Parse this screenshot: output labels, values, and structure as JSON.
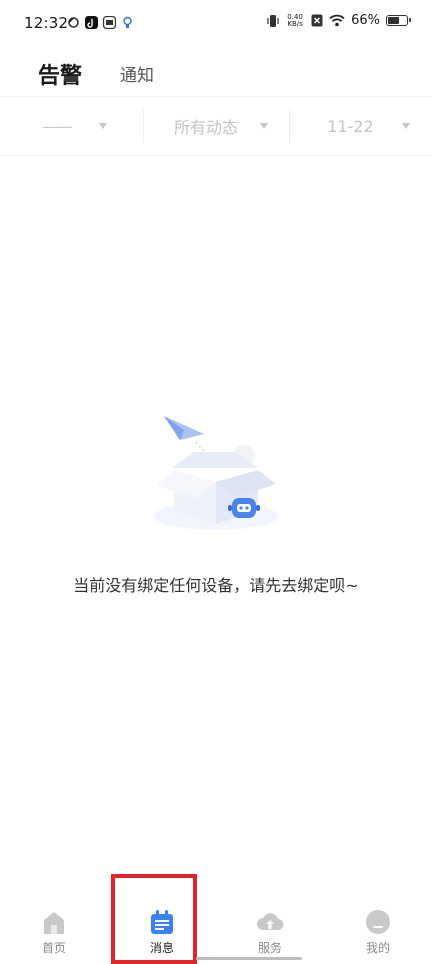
{
  "status_bar": {
    "time": "12:32",
    "net_speed_value": "0.40",
    "net_speed_unit": "KB/s",
    "battery_text": "66%",
    "battery_level": 0.66,
    "icons": [
      "sync-icon",
      "tiktok-icon",
      "app-icon",
      "bulb-icon",
      "vibrate-icon",
      "no-sim-icon",
      "wifi-icon",
      "battery-icon"
    ]
  },
  "header": {
    "tabs": [
      {
        "label": "告警",
        "active": true
      },
      {
        "label": "通知",
        "active": false
      }
    ]
  },
  "filters": {
    "device": "——",
    "dynamics": "所有动态",
    "date": "11-22"
  },
  "empty_state": {
    "message": "当前没有绑定任何设备，请先去绑定呗~",
    "illustration": "paper-plane-box-robot"
  },
  "bottom_nav": {
    "items": [
      {
        "label": "首页",
        "icon": "home-icon",
        "active": false
      },
      {
        "label": "消息",
        "icon": "message-calendar-icon",
        "active": true
      },
      {
        "label": "服务",
        "icon": "cloud-upload-icon",
        "active": false
      },
      {
        "label": "我的",
        "icon": "profile-icon",
        "active": false
      }
    ]
  },
  "colors": {
    "accent": "#3b82f6",
    "highlight_box": "#e0262a",
    "inactive_icon": "#c9c9c9"
  }
}
